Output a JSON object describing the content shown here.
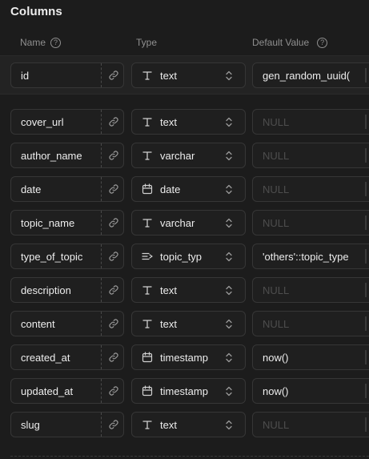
{
  "section": {
    "title": "Columns"
  },
  "headers": {
    "name": "Name",
    "type": "Type",
    "default": "Default Value",
    "help_glyph": "?"
  },
  "columns": [
    {
      "name": "id",
      "type": "text",
      "type_icon": "text-type-icon",
      "default": "gen_random_uuid(",
      "placeholder": false
    },
    {
      "name": "cover_url",
      "type": "text",
      "type_icon": "text-type-icon",
      "default": "NULL",
      "placeholder": true
    },
    {
      "name": "author_name",
      "type": "varchar",
      "type_icon": "text-type-icon",
      "default": "NULL",
      "placeholder": true
    },
    {
      "name": "date",
      "type": "date",
      "type_icon": "calendar-icon",
      "default": "NULL",
      "placeholder": true
    },
    {
      "name": "topic_name",
      "type": "varchar",
      "type_icon": "text-type-icon",
      "default": "NULL",
      "placeholder": true
    },
    {
      "name": "type_of_topic",
      "type": "topic_typ",
      "type_icon": "enum-list-icon",
      "default": "'others'::topic_type",
      "placeholder": false
    },
    {
      "name": "description",
      "type": "text",
      "type_icon": "text-type-icon",
      "default": "NULL",
      "placeholder": true
    },
    {
      "name": "content",
      "type": "text",
      "type_icon": "text-type-icon",
      "default": "NULL",
      "placeholder": true
    },
    {
      "name": "created_at",
      "type": "timestamp",
      "type_icon": "calendar-icon",
      "default": "now()",
      "placeholder": false
    },
    {
      "name": "updated_at",
      "type": "timestamp",
      "type_icon": "calendar-icon",
      "default": "now()",
      "placeholder": false
    },
    {
      "name": "slug",
      "type": "text",
      "type_icon": "text-type-icon",
      "default": "NULL",
      "placeholder": true
    }
  ],
  "colors": {
    "background": "#1c1c1c",
    "field_border": "#363636",
    "text": "#ededed",
    "muted": "#8f8f8f",
    "placeholder": "#4d4d4d"
  }
}
